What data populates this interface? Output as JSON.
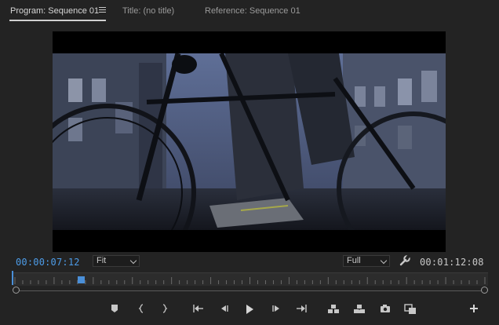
{
  "tabs": [
    {
      "label": "Program: Sequence 01",
      "active": true
    },
    {
      "label": "Title: (no title)",
      "active": false
    },
    {
      "label": "Reference: Sequence 01",
      "active": false
    }
  ],
  "icons": {
    "panel_menu": "hamburger-menu-icon",
    "settings": "wrench-icon"
  },
  "playback": {
    "current_timecode": "00:00:07:12",
    "duration_timecode": "00:01:12:08",
    "zoom_label": "Fit",
    "resolution_label": "Full"
  },
  "timeline": {
    "playhead_fraction": 0.14
  },
  "transport_buttons": [
    {
      "name": "add-marker-button",
      "icon": "marker-icon"
    },
    {
      "name": "mark-in-button",
      "icon": "mark-in-icon"
    },
    {
      "name": "mark-out-button",
      "icon": "mark-out-icon"
    },
    {
      "name": "go-to-in-button",
      "icon": "go-to-in-icon"
    },
    {
      "name": "step-back-button",
      "icon": "step-back-icon"
    },
    {
      "name": "play-button",
      "icon": "play-icon"
    },
    {
      "name": "step-forward-button",
      "icon": "step-forward-icon"
    },
    {
      "name": "go-to-out-button",
      "icon": "go-to-out-icon"
    },
    {
      "name": "insert-button",
      "icon": "insert-icon"
    },
    {
      "name": "overwrite-button",
      "icon": "overwrite-icon"
    },
    {
      "name": "export-frame-button",
      "icon": "camera-icon"
    },
    {
      "name": "comparison-view-button",
      "icon": "comparison-view-icon"
    },
    {
      "name": "button-editor-button",
      "icon": "plus-icon"
    }
  ],
  "colors": {
    "accent": "#4d9ce8",
    "panel_bg": "#232323"
  }
}
